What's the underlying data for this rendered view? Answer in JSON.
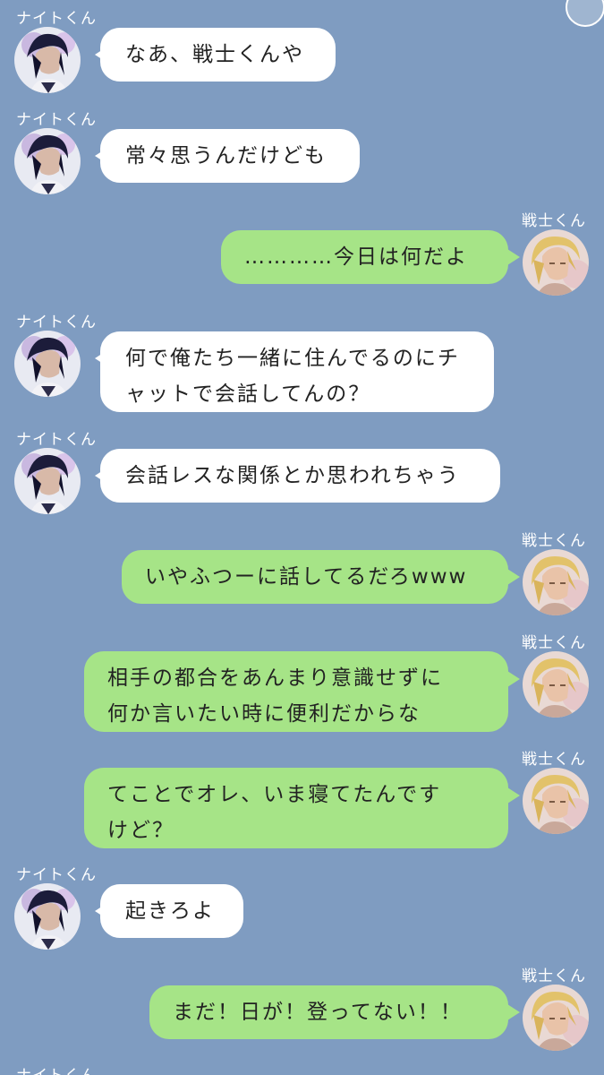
{
  "app": {
    "background_color": "#7f9cc1"
  },
  "participants": {
    "knight": {
      "name": "ナイトくん",
      "avatar_icon": "dark-haired-character-avatar-icon"
    },
    "warrior": {
      "name": "戦士くん",
      "avatar_icon": "blond-character-avatar-icon"
    }
  },
  "colors": {
    "incoming_bubble": "#ffffff",
    "outgoing_bubble": "#a6e487",
    "name_text": "#ffffff"
  },
  "messages": [
    {
      "sender": "ナイトくん",
      "text": "なあ、戦士くんや"
    },
    {
      "sender": "ナイトくん",
      "text": "常々思うんだけども"
    },
    {
      "sender": "戦士くん",
      "text": "…………今日は何だよ"
    },
    {
      "sender": "ナイトくん",
      "text": "何で俺たち一緒に住んでるのにチャットで会話してんの？"
    },
    {
      "sender": "ナイトくん",
      "text": "会話レスな関係とか思われちゃう"
    },
    {
      "sender": "戦士くん",
      "text": "いやふつーに話してるだろwww"
    },
    {
      "sender": "戦士くん",
      "text": "相手の都合をあんまり意識せずに\n何か言いたい時に便利だからな"
    },
    {
      "sender": "戦士くん",
      "text": "てことでオレ、いま寝てたんです\nけど？"
    },
    {
      "sender": "ナイトくん",
      "text": "起きろよ"
    },
    {
      "sender": "戦士くん",
      "text": "まだ！日が！登ってない！！"
    },
    {
      "sender": "ナイトくん",
      "text": ""
    }
  ]
}
